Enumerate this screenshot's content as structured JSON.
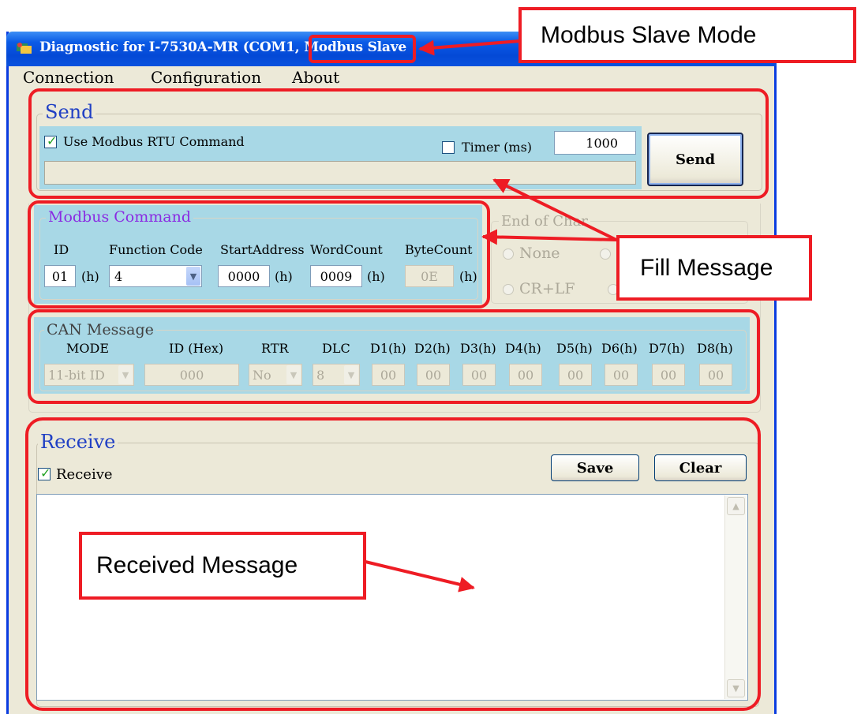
{
  "window": {
    "title_prefix": "Diagnostic for I-7530A-MR (COM1, ",
    "title_mode": "Modbus Slave"
  },
  "menu": [
    "Connection",
    "Configuration",
    "About"
  ],
  "send": {
    "group_title": "Send",
    "use_modbus_label": "Use Modbus RTU Command",
    "use_modbus_checked": true,
    "timer_label": "Timer (ms)",
    "timer_checked": false,
    "timer_value": "1000",
    "send_button": "Send",
    "message_value": ""
  },
  "modbus": {
    "group_title": "Modbus Command",
    "id_label": "ID",
    "id_value": "01",
    "h": "(h)",
    "function_label": "Function Code",
    "function_value": "4",
    "start_label": "StartAddress",
    "start_value": "0000",
    "word_label": "WordCount",
    "word_value": "0009",
    "byte_label": "ByteCount",
    "byte_value": "0E"
  },
  "end_of_char": {
    "group_title": "End of Char",
    "options": [
      "None",
      "CR+LF"
    ]
  },
  "can": {
    "group_title": "CAN Message",
    "headers": [
      "MODE",
      "ID (Hex)",
      "RTR",
      "DLC",
      "D1(h)",
      "D2(h)",
      "D3(h)",
      "D4(h)",
      "D5(h)",
      "D6(h)",
      "D7(h)",
      "D8(h)"
    ],
    "mode_value": "11-bit ID",
    "id_value": "000",
    "rtr_value": "No",
    "dlc_value": "8",
    "data_values": [
      "00",
      "00",
      "00",
      "00",
      "00",
      "00",
      "00",
      "00"
    ]
  },
  "receive": {
    "group_title": "Receive",
    "receive_label": "Receive",
    "receive_checked": true,
    "save_button": "Save",
    "clear_button": "Clear",
    "log": ""
  },
  "annotations": {
    "slave_mode": "Modbus Slave Mode",
    "fill_message": "Fill Message",
    "received_message": "Received Message",
    "color": "#ee1c24"
  },
  "colors": {
    "titlebar": "#0449d6",
    "panel_blue": "#a8d8e6",
    "window_bg": "#ece9d8",
    "group_title": "#1f3fc4",
    "modbus_title": "#8a2be2"
  }
}
